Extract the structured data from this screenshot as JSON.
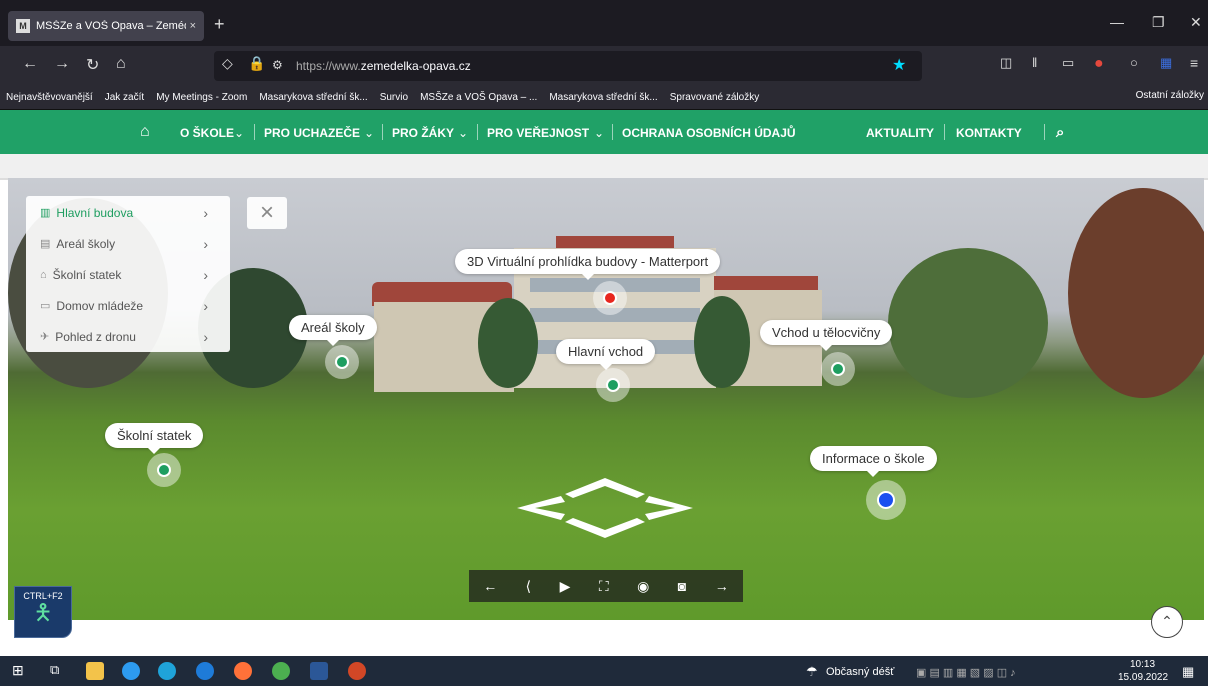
{
  "browser": {
    "tab_title": "MSŠZe a VOŠ Opava – Zeméděl",
    "tab_close": "×",
    "new_tab": "+",
    "url_domain_prefix": "https://www.",
    "url_domain": "zemedelka-opava.cz",
    "bookmarks": [
      "Nejnavštěvovanější",
      "Jak začít",
      "My Meetings - Zoom",
      "Masarykova střední šk...",
      "Survio",
      "MSŠZe a VOŠ Opava – ...",
      "Masarykova střední šk...",
      "Spravované záložky"
    ],
    "other_bookmarks": "Ostatní záložky"
  },
  "site_nav": {
    "items": [
      "O ŠKOLE",
      "PRO UCHAZEČE",
      "PRO ŽÁKY",
      "PRO VEŘEJNOST",
      "OCHRANA OSOBNÍCH ÚDAJŮ"
    ],
    "right_items": [
      "AKTUALITY",
      "KONTAKTY"
    ]
  },
  "pano_menu": {
    "items": [
      "Hlavní budova",
      "Areál školy",
      "Školní statek",
      "Domov mládeže",
      "Pohled z dronu"
    ]
  },
  "hotspots": {
    "virtual_tour": "3D Virtuální prohlídka budovy - Matterport",
    "areal": "Areál školy",
    "main_entrance": "Hlavní vchod",
    "gym_entrance": "Vchod u tělocvičny",
    "statek": "Školní statek",
    "info": "Informace o škole"
  },
  "accessibility_badge": "CTRL+F2",
  "taskbar": {
    "weather": "Občasný déšť",
    "time": "10:13",
    "date": "15.09.2022"
  },
  "colors": {
    "accent": "#20a167",
    "hotspot_red": "#e8261e",
    "hotspot_blue": "#1a4ff0",
    "hotspot_green": "#1e9e60"
  }
}
